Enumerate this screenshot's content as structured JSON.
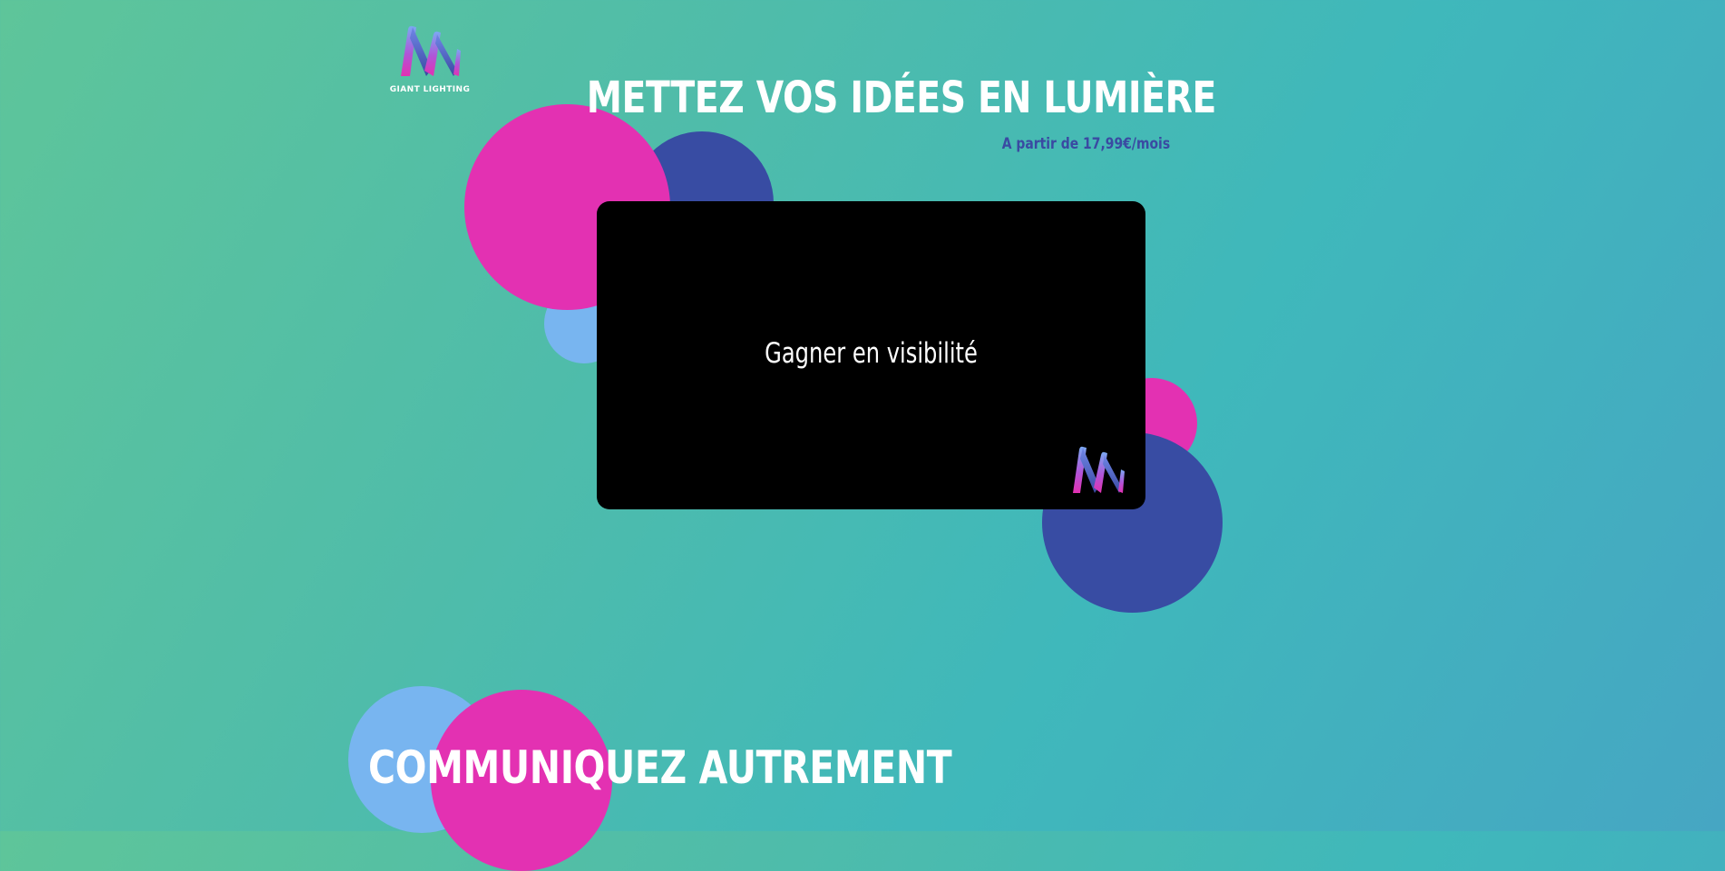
{
  "brand": {
    "name": "GIANT LIGHTING",
    "logo_icon": "giant-lighting-m-logo",
    "colors": {
      "magenta": "#e331b2",
      "navy": "#384ca3",
      "light_blue": "#78b5f0",
      "teal_background": "#40b9b5"
    }
  },
  "hero": {
    "title": "METTEZ VOS IDÉES EN LUMIÈRE",
    "price": "A partir de 17,99€/mois"
  },
  "video": {
    "caption": "Gagner en visibilité",
    "watermark_icon": "giant-lighting-m-logo"
  },
  "section": {
    "title": "COMMUNIQUEZ AUTREMENT"
  }
}
